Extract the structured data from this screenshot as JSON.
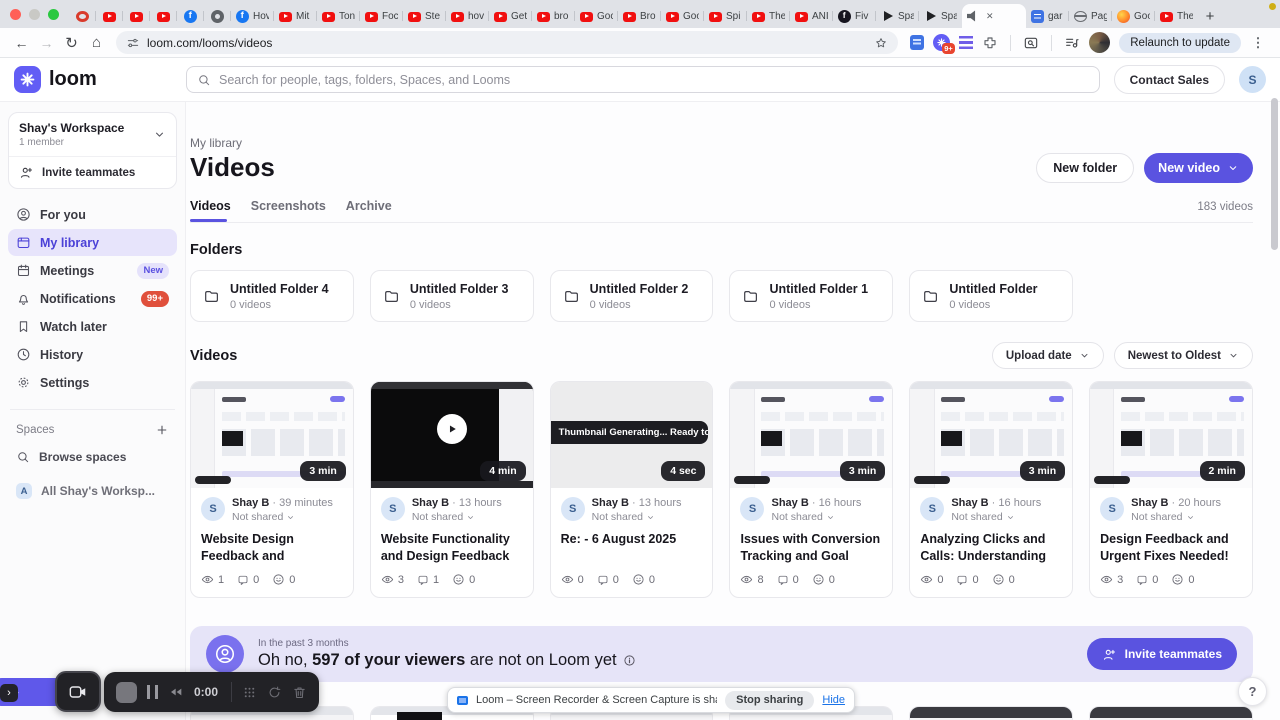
{
  "browser": {
    "tabs": [
      {
        "icon": "record",
        "label": "",
        "state": "pinned"
      },
      {
        "icon": "youtube",
        "label": "",
        "state": "pinned"
      },
      {
        "icon": "youtube",
        "label": "",
        "state": "pinned"
      },
      {
        "icon": "youtube",
        "label": "",
        "state": "pinned"
      },
      {
        "icon": "facebook",
        "label": "",
        "state": "pinned"
      },
      {
        "icon": "gear",
        "label": "",
        "state": "pinned"
      },
      {
        "icon": "facebook",
        "label": "Hov",
        "state": ""
      },
      {
        "icon": "youtube",
        "label": "Mit",
        "state": ""
      },
      {
        "icon": "youtube",
        "label": "Ton",
        "state": ""
      },
      {
        "icon": "youtube",
        "label": "Foc",
        "state": ""
      },
      {
        "icon": "youtube",
        "label": "Ste",
        "state": ""
      },
      {
        "icon": "youtube",
        "label": "hov",
        "state": ""
      },
      {
        "icon": "youtube",
        "label": "Get",
        "state": ""
      },
      {
        "icon": "youtube",
        "label": "bro",
        "state": ""
      },
      {
        "icon": "youtube",
        "label": "Goc",
        "state": ""
      },
      {
        "icon": "youtube",
        "label": "Bro",
        "state": ""
      },
      {
        "icon": "youtube",
        "label": "Goo",
        "state": ""
      },
      {
        "icon": "youtube",
        "label": "Spi",
        "state": ""
      },
      {
        "icon": "youtube",
        "label": "The",
        "state": ""
      },
      {
        "icon": "youtube",
        "label": "ANI",
        "state": ""
      },
      {
        "icon": "fiverr",
        "label": "Fiv",
        "state": ""
      },
      {
        "icon": "play",
        "label": "Spa",
        "state": ""
      },
      {
        "icon": "play",
        "label": "Spa",
        "state": ""
      },
      {
        "icon": "speaker",
        "label": "",
        "state": "active"
      },
      {
        "icon": "doc",
        "label": "gar",
        "state": ""
      },
      {
        "icon": "globe",
        "label": "Pag",
        "state": ""
      },
      {
        "icon": "firefox",
        "label": "Goo",
        "state": ""
      },
      {
        "icon": "youtube",
        "label": "The",
        "state": ""
      }
    ],
    "url": "loom.com/looms/videos",
    "ext_badge": "9+",
    "relaunch_label": "Relaunch to update"
  },
  "header": {
    "logo_text": "loom",
    "search_placeholder": "Search for people, tags, folders, Spaces, and Looms",
    "contact_sales": "Contact Sales",
    "avatar_initial": "S"
  },
  "sidebar": {
    "workspace": {
      "name": "Shay's Workspace",
      "members": "1 member"
    },
    "invite_label": "Invite teammates",
    "items": [
      {
        "icon": "user",
        "label": "For you",
        "state": "",
        "badge": "",
        "badge_style": ""
      },
      {
        "icon": "library",
        "label": "My library",
        "state": "active",
        "badge": "",
        "badge_style": ""
      },
      {
        "icon": "calendar",
        "label": "Meetings",
        "state": "",
        "badge": "New",
        "badge_style": "new"
      },
      {
        "icon": "bell",
        "label": "Notifications",
        "state": "",
        "badge": "99+",
        "badge_style": "count"
      },
      {
        "icon": "bookmark",
        "label": "Watch later",
        "state": "",
        "badge": "",
        "badge_style": ""
      },
      {
        "icon": "clock",
        "label": "History",
        "state": "",
        "badge": "",
        "badge_style": ""
      },
      {
        "icon": "gear",
        "label": "Settings",
        "state": "",
        "badge": "",
        "badge_style": ""
      }
    ],
    "spaces_label": "Spaces",
    "browse_spaces": "Browse spaces",
    "space": {
      "initial": "A",
      "name": "All Shay's Worksp..."
    }
  },
  "main": {
    "breadcrumb": "My library",
    "title": "Videos",
    "new_folder": "New folder",
    "new_video": "New video",
    "tabs": [
      {
        "label": "Videos",
        "state": "active"
      },
      {
        "label": "Screenshots",
        "state": ""
      },
      {
        "label": "Archive",
        "state": ""
      }
    ],
    "video_count": "183 videos",
    "folders_heading": "Folders",
    "folders": [
      {
        "name": "Untitled Folder 4",
        "count": "0 videos"
      },
      {
        "name": "Untitled Folder 3",
        "count": "0 videos"
      },
      {
        "name": "Untitled Folder 2",
        "count": "0 videos"
      },
      {
        "name": "Untitled Folder 1",
        "count": "0 videos"
      },
      {
        "name": "Untitled Folder",
        "count": "0 videos"
      }
    ],
    "videos_heading": "Videos",
    "sort_field": "Upload date",
    "sort_order": "Newest to Oldest",
    "videos": [
      {
        "thumb": "page",
        "duration": "3 min",
        "badge": "",
        "author": "Shay B",
        "time": "39 minutes",
        "shared": "Not shared",
        "title": "Website Design Feedback and Suggestions 🖥️",
        "views": 1,
        "comments": 0,
        "reactions": 0
      },
      {
        "thumb": "dark",
        "duration": "4 min",
        "badge": "",
        "author": "Shay B",
        "time": "13 hours",
        "shared": "Not shared",
        "title": "Website Functionality and Design Feedback 🛠️",
        "views": 3,
        "comments": 1,
        "reactions": 0
      },
      {
        "thumb": "plain",
        "duration": "4 sec",
        "badge": "Thumbnail Generating... Ready to Play",
        "author": "Shay B",
        "time": "13 hours",
        "shared": "Not shared",
        "title": "Re: - 6 August 2025",
        "views": 0,
        "comments": 0,
        "reactions": 0
      },
      {
        "thumb": "page",
        "duration": "3 min",
        "badge": "",
        "author": "Shay B",
        "time": "16 hours",
        "shared": "Not shared",
        "title": "Issues with Conversion Tracking and Goal Setup",
        "views": 8,
        "comments": 0,
        "reactions": 0
      },
      {
        "thumb": "page",
        "duration": "3 min",
        "badge": "",
        "author": "Shay B",
        "time": "16 hours",
        "shared": "Not shared",
        "title": "Analyzing Clicks and Calls: Understanding Conversion...",
        "views": 0,
        "comments": 0,
        "reactions": 0
      },
      {
        "thumb": "page",
        "duration": "2 min",
        "badge": "",
        "author": "Shay B",
        "time": "20 hours",
        "shared": "Not shared",
        "title": "Design Feedback and Urgent Fixes Needed! ⚠️",
        "views": 3,
        "comments": 0,
        "reactions": 0
      }
    ],
    "banner": {
      "period": "In the past 3 months",
      "text_pre": "Oh no, ",
      "text_bold": "597 of your viewers",
      "text_post": " are not on Loom yet",
      "button": "Invite teammates"
    }
  },
  "overlays": {
    "recorder": {
      "timer": "0:00"
    },
    "share_bar": {
      "message": "Loom – Screen Recorder & Screen Capture is sharing your screen.",
      "stop": "Stop sharing",
      "hide": "Hide"
    },
    "help": "?"
  },
  "colors": {
    "brand_purple": "#625df5",
    "new_video_button": "#5a53e0",
    "notification_badge": "#e0503c",
    "banner_background": "#e6e4f8"
  },
  "icons": {
    "loom-logo": "8-spoke asterisk",
    "search": "magnifier",
    "notifications": "bell",
    "watch-later": "bookmark",
    "history": "clock",
    "settings": "gear",
    "stats": [
      "eye",
      "comment-bubble",
      "smiley"
    ]
  }
}
